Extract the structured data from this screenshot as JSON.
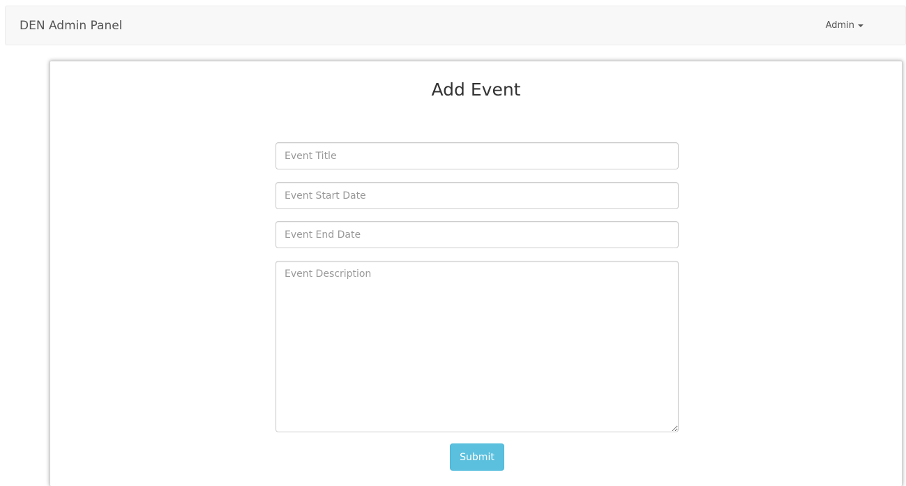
{
  "navbar": {
    "brand": "DEN Admin Panel",
    "user_menu_label": "Admin"
  },
  "form": {
    "title": "Add Event",
    "fields": {
      "event_title": {
        "placeholder": "Event Title",
        "value": ""
      },
      "event_start_date": {
        "placeholder": "Event Start Date",
        "value": ""
      },
      "event_end_date": {
        "placeholder": "Event End Date",
        "value": ""
      },
      "event_description": {
        "placeholder": "Event Description",
        "value": ""
      }
    },
    "submit_label": "Submit"
  },
  "colors": {
    "navbar_bg": "#f8f8f8",
    "submit_bg": "#5bc0de",
    "submit_border": "#46b8da"
  },
  "icons": {
    "user_menu_caret": "caret-down-icon"
  }
}
